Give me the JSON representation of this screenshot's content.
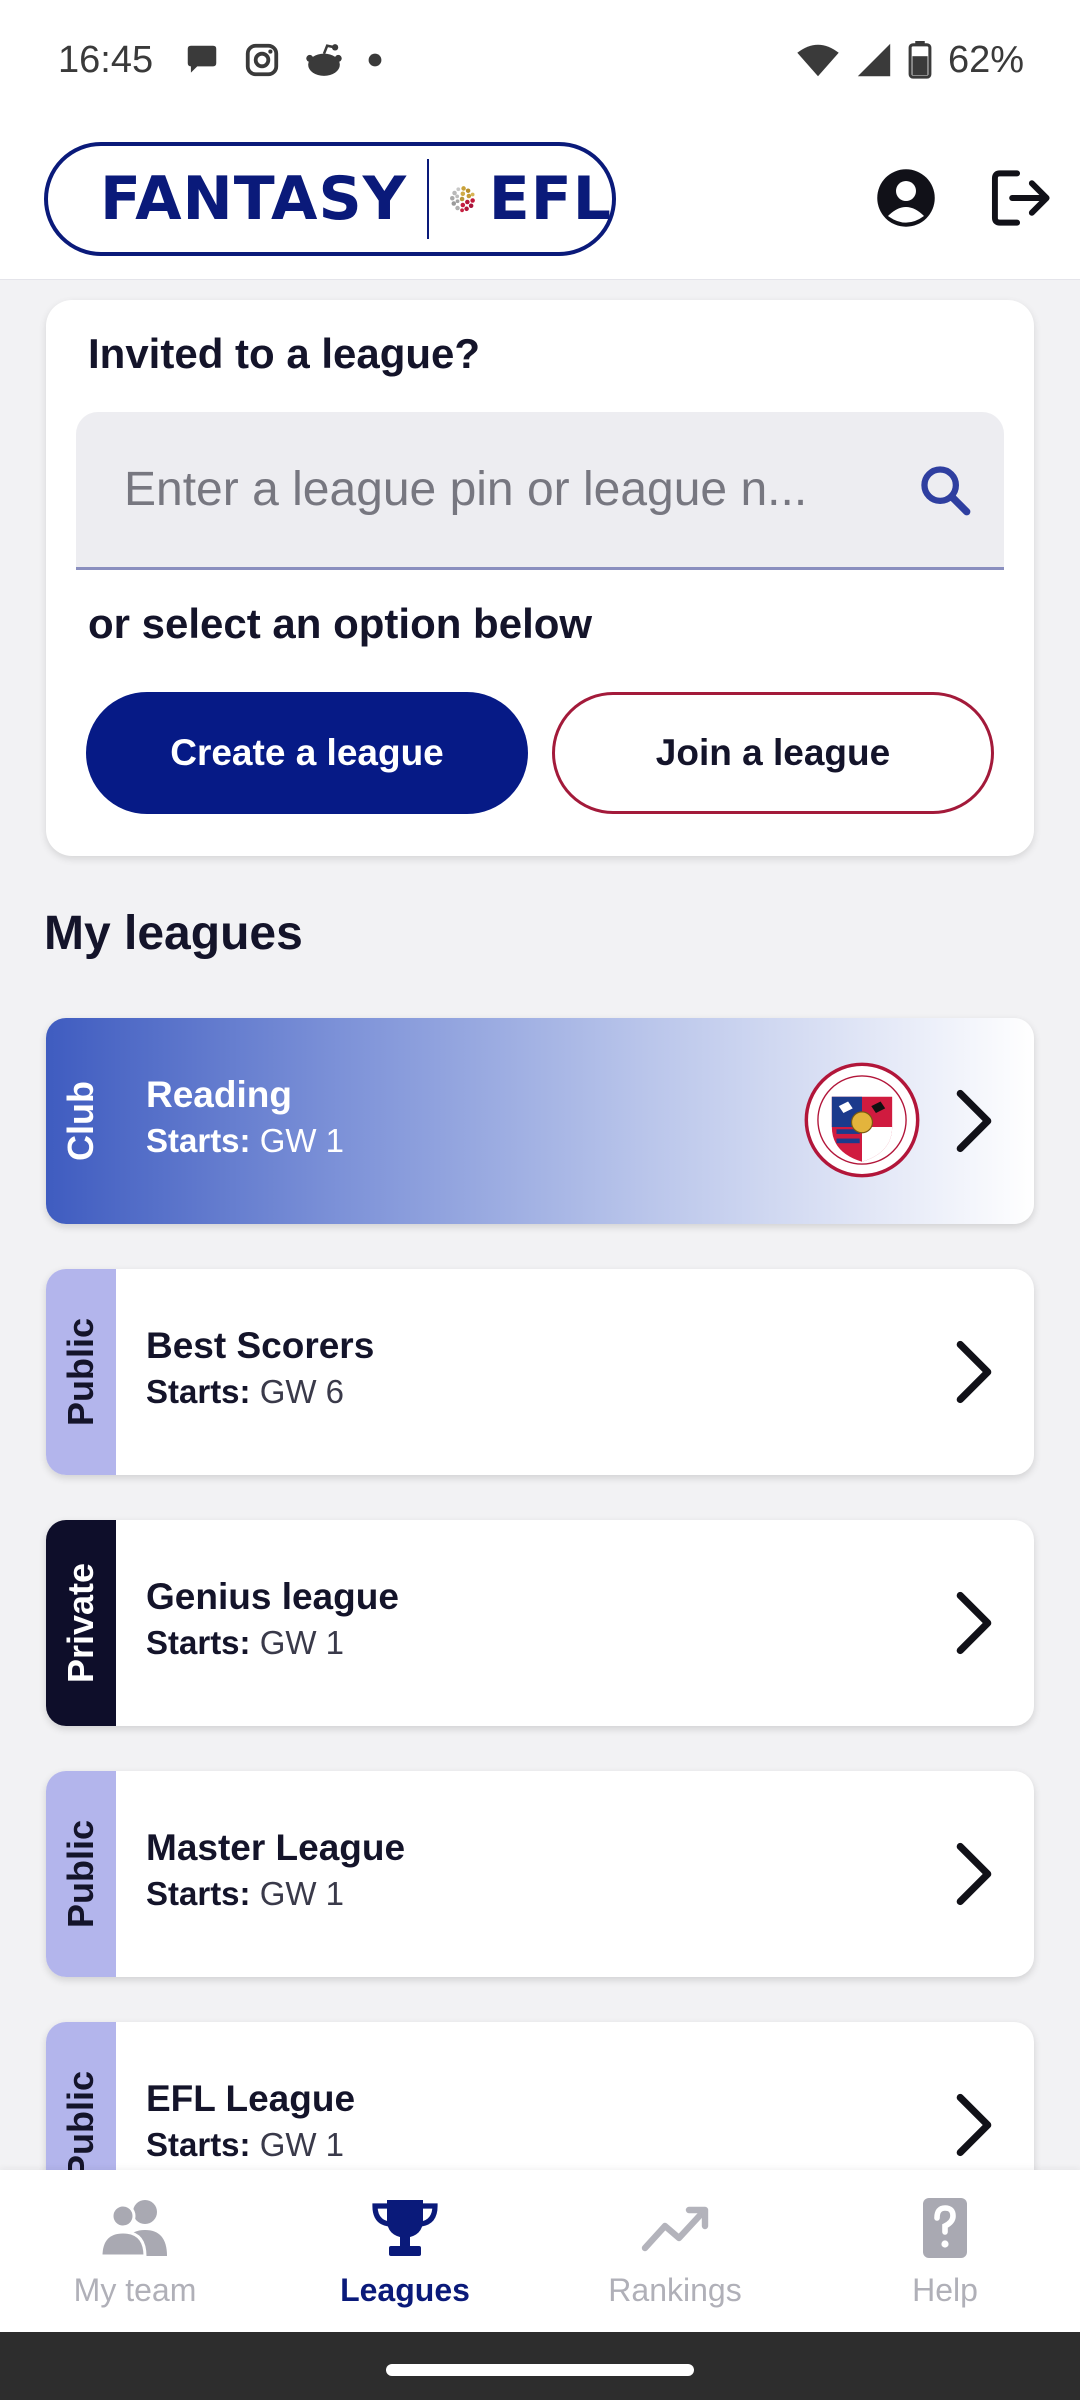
{
  "status_bar": {
    "time": "16:45",
    "battery": "62%",
    "left_icons": [
      "chat-bubble-icon",
      "instagram-icon",
      "reddit-icon",
      "dot-icon"
    ],
    "right_icons": [
      "wifi-icon",
      "signal-icon",
      "battery-icon"
    ]
  },
  "header": {
    "logo_left": "FANTASY",
    "logo_right": "EFL"
  },
  "invite": {
    "title": "Invited to a league?",
    "search_placeholder": "Enter a league pin or league n...",
    "or_text": "or select an option below",
    "create_label": "Create a league",
    "join_label": "Join a league"
  },
  "my_leagues": {
    "title": "My leagues",
    "starts_label": "Starts:",
    "items": [
      {
        "tag": "Club",
        "name": "Reading",
        "starts": "GW 1"
      },
      {
        "tag": "Public",
        "name": "Best Scorers",
        "starts": "GW 6"
      },
      {
        "tag": "Private",
        "name": "Genius league",
        "starts": "GW 1"
      },
      {
        "tag": "Public",
        "name": "Master League",
        "starts": "GW 1"
      },
      {
        "tag": "Public",
        "name": "EFL League",
        "starts": "GW 1"
      }
    ]
  },
  "bottom_nav": {
    "items": [
      {
        "label": "My team",
        "icon": "team-icon"
      },
      {
        "label": "Leagues",
        "icon": "trophy-icon",
        "active": true
      },
      {
        "label": "Rankings",
        "icon": "trend-icon"
      },
      {
        "label": "Help",
        "icon": "help-icon"
      }
    ]
  },
  "colors": {
    "brand_navy": "#061a86",
    "accent_crimson": "#a31a3a",
    "public_tag": "#b3b5ec",
    "private_tag": "#0e0e2a"
  }
}
